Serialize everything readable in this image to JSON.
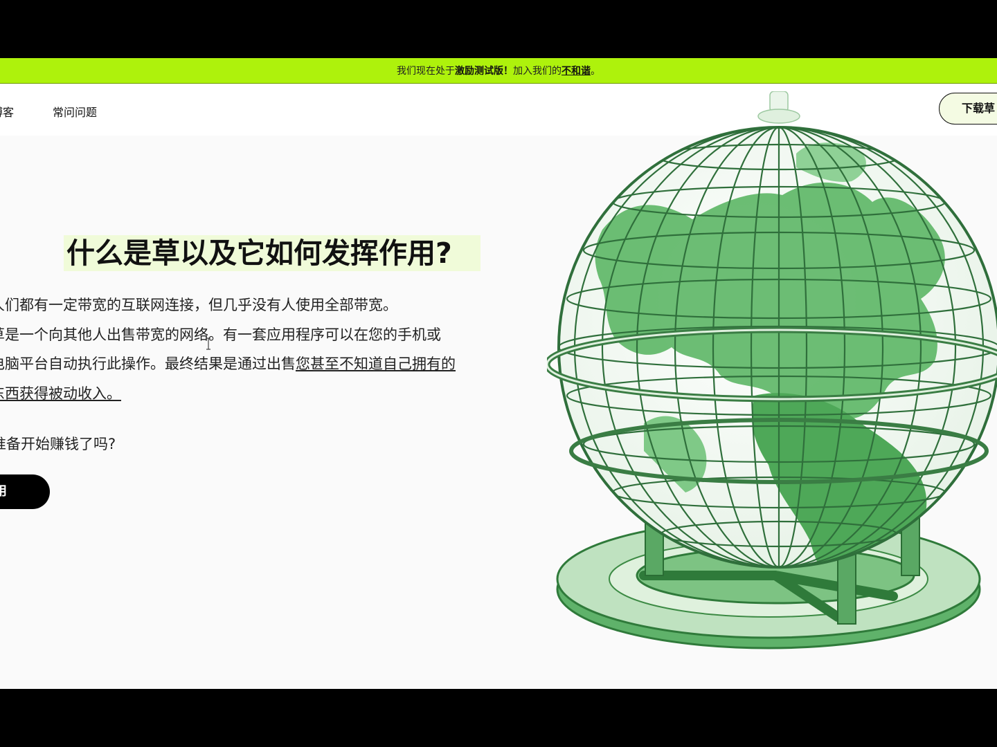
{
  "banner": {
    "prefix": "我们现在处于",
    "highlight": "激励测试版！",
    "middle": "加入我们的",
    "link": "不和谐",
    "suffix": "。"
  },
  "nav": {
    "blog": "博客",
    "faq": "常问问题",
    "download": "下载草"
  },
  "hero": {
    "title": "什么是草以及它如何发挥作用?",
    "line1": "人们都有一定带宽的互联网连接，但几乎没有人使用全部带宽。",
    "line2": "草是一个向其他人出售带宽的网络。有一套应用程序可以在您的手机或",
    "line3_plain": "电脑平台自动执行此操作。最终结果是通过出售",
    "line3_link": "您甚至不知道自己拥有的",
    "line4_link": "东西获得被动收入。",
    "question": "准备开始赚钱了吗?",
    "cta": "立即使用"
  },
  "colors": {
    "banner": "#aef20c",
    "title_highlight": "#f0fbd9",
    "globe_green": "#3c9a47"
  },
  "icons": {
    "globe": "globe-illustration",
    "cursor": "text-cursor-icon"
  }
}
